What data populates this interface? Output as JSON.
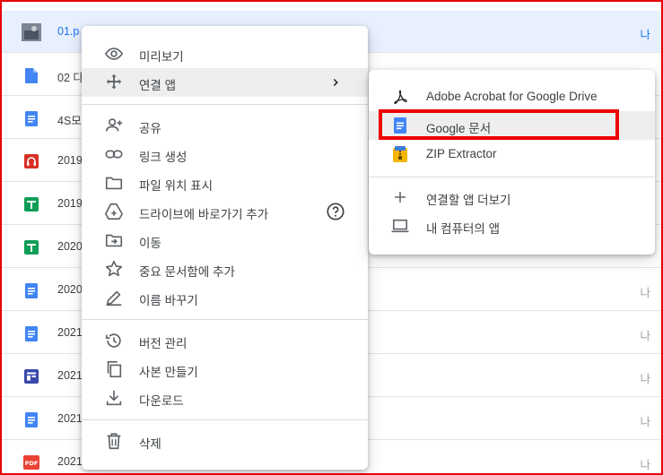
{
  "files": [
    {
      "name": "01.p",
      "owner": "나",
      "icon": "image-thumbnail-icon",
      "selected": true
    },
    {
      "name": "02 다",
      "owner": "",
      "icon": "blue-file-icon"
    },
    {
      "name": "4S모",
      "owner": "",
      "icon": "docs-icon"
    },
    {
      "name": "2019",
      "owner": "",
      "icon": "audio-file-icon"
    },
    {
      "name": "2019",
      "owner": "",
      "icon": "sheets-icon"
    },
    {
      "name": "2020",
      "owner": "",
      "icon": "sheets-icon"
    },
    {
      "name": "2020",
      "owner": "나",
      "icon": "docs-icon"
    },
    {
      "name": "2021",
      "owner": "나",
      "icon": "docs-icon"
    },
    {
      "name": "2021",
      "owner": "나",
      "icon": "forms-icon"
    },
    {
      "name": "2021",
      "owner": "나",
      "icon": "docs-icon"
    },
    {
      "name": "2021",
      "owner": "나",
      "icon": "pdf-icon"
    }
  ],
  "menu": {
    "preview": "미리보기",
    "open_with": "연결 앱",
    "share": "공유",
    "get_link": "링크 생성",
    "show_location": "파일 위치 표시",
    "add_shortcut": "드라이브에 바로가기 추가",
    "move": "이동",
    "star": "중요 문서함에 추가",
    "rename": "이름 바꾸기",
    "versions": "버전 관리",
    "copy": "사본 만들기",
    "download": "다운로드",
    "delete": "삭제"
  },
  "submenu": {
    "acrobat": "Adobe Acrobat for Google Drive",
    "google_docs": "Google 문서",
    "zip": "ZIP Extractor",
    "more_apps": "연결할 앱 더보기",
    "computer_apps": "내 컴퓨터의 앱"
  },
  "pdf_badge": "PDF",
  "colors": {
    "highlight": "#ee0000",
    "selected_row": "#e8f0fe",
    "accent_blue": "#1a73e8",
    "docs_blue": "#4285f4",
    "sheets_green": "#0f9d58",
    "audio_red": "#d93025",
    "forms_indigo": "#3949ab"
  }
}
